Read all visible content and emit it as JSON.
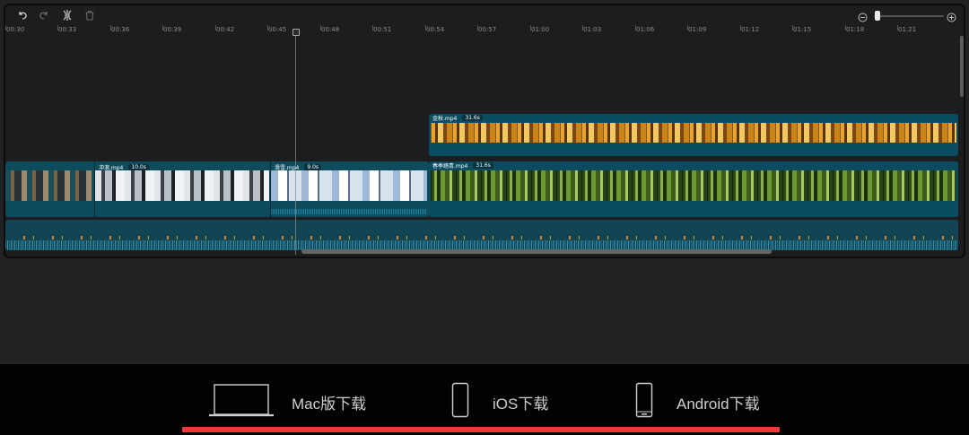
{
  "timeline": {
    "ruler_labels": [
      "00:30",
      "00:33",
      "00:36",
      "00:39",
      "00:42",
      "00:45",
      "00:48",
      "00:51",
      "00:54",
      "00:57",
      "01:00",
      "01:03",
      "01:06",
      "01:09",
      "01:12",
      "01:15",
      "01:18",
      "01:21"
    ],
    "clips": {
      "gold": {
        "name": "金秋.mp4",
        "duration": "31.6s"
      },
      "forest": {
        "name": "春季踏青.mp4",
        "duration": "31.6s"
      },
      "surf": {
        "name": "冲浪.mp4",
        "duration": "10.0s"
      },
      "ski": {
        "name": "滑雪.mp4",
        "duration": "9.0s"
      }
    }
  },
  "downloads": {
    "mac": "Mac版下载",
    "ios": "iOS下载",
    "android": "Android下载"
  },
  "colors": {
    "accent_underline": "#e83a3a",
    "clip_border": "#0b4d60"
  }
}
